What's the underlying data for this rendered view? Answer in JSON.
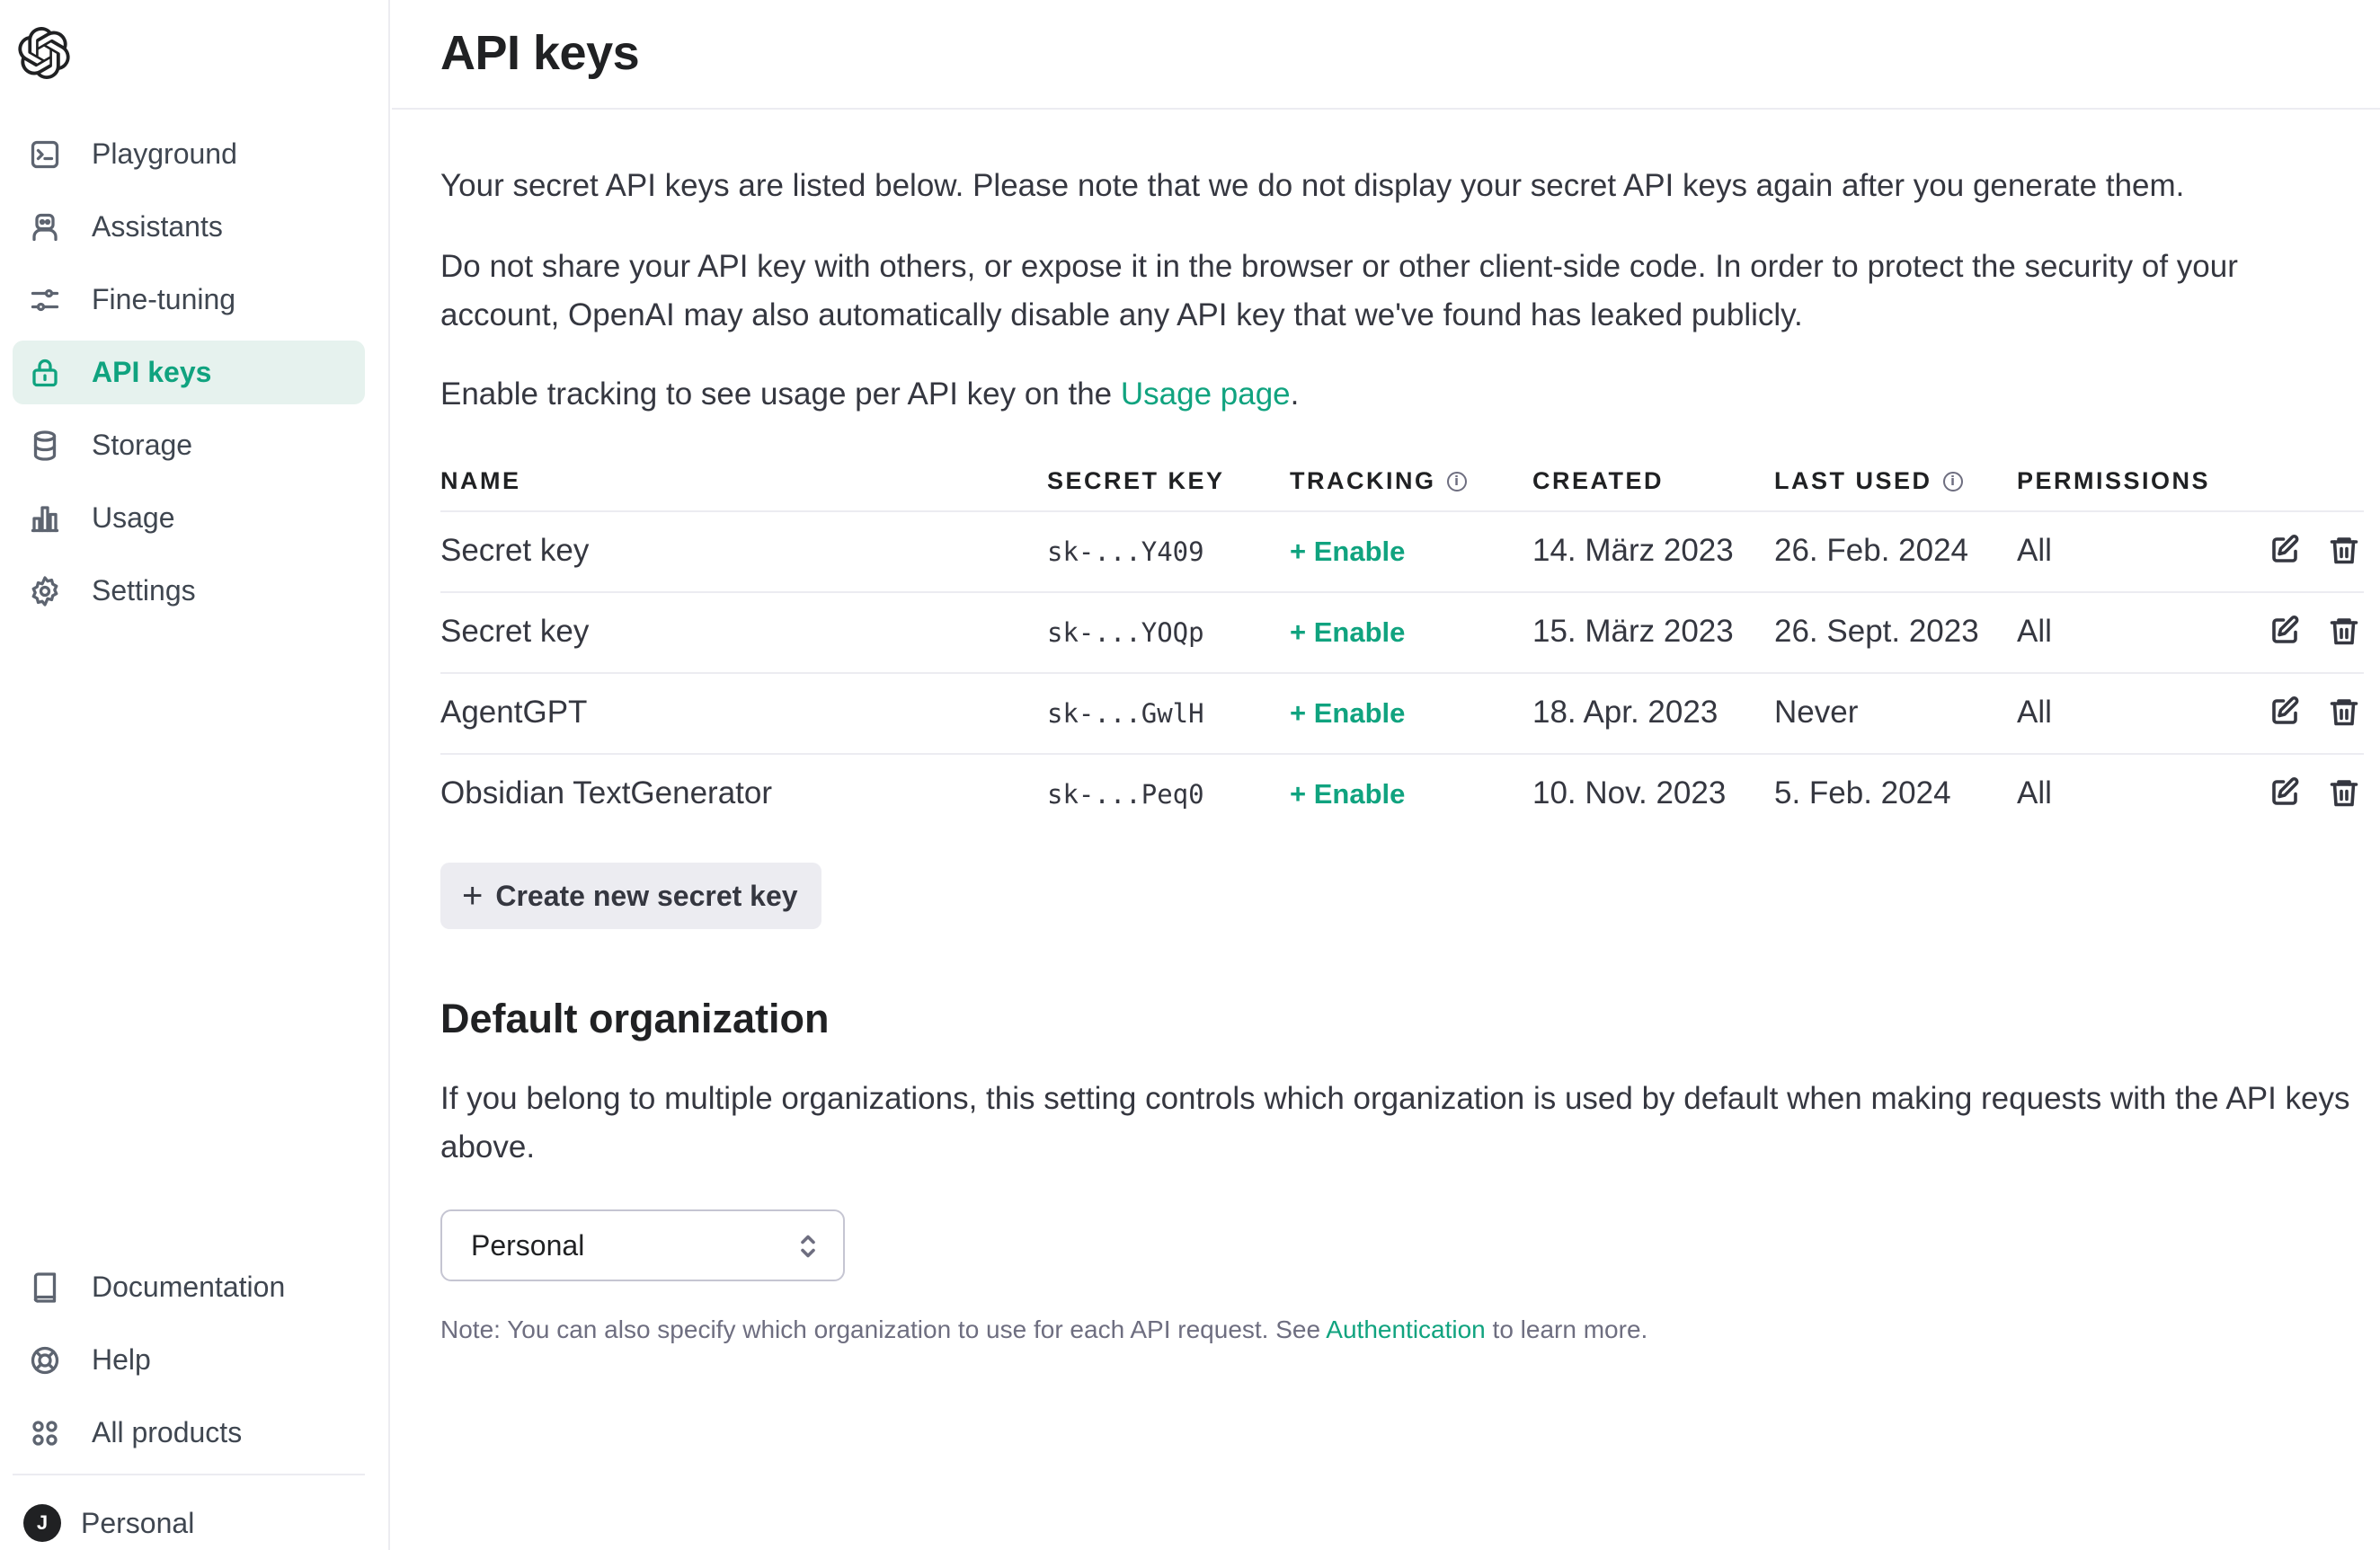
{
  "sidebar": {
    "logo_icon": "openai-logo-icon",
    "nav": [
      {
        "label": "Playground",
        "icon": "terminal-icon",
        "active": false
      },
      {
        "label": "Assistants",
        "icon": "robot-icon",
        "active": false
      },
      {
        "label": "Fine-tuning",
        "icon": "sliders-icon",
        "active": false
      },
      {
        "label": "API keys",
        "icon": "lock-icon",
        "active": true
      },
      {
        "label": "Storage",
        "icon": "database-icon",
        "active": false
      },
      {
        "label": "Usage",
        "icon": "bar-chart-icon",
        "active": false
      },
      {
        "label": "Settings",
        "icon": "gear-icon",
        "active": false
      }
    ],
    "bottom_nav": [
      {
        "label": "Documentation",
        "icon": "book-icon"
      },
      {
        "label": "Help",
        "icon": "lifebuoy-icon"
      },
      {
        "label": "All products",
        "icon": "grid-icon"
      }
    ],
    "user": {
      "initial": "J",
      "name": "Personal"
    }
  },
  "header": {
    "title": "API keys"
  },
  "main": {
    "intro1": "Your secret API keys are listed below. Please note that we do not display your secret API keys again after you generate them.",
    "intro2": "Do not share your API key with others, or expose it in the browser or other client-side code. In order to protect the security of your account, OpenAI may also automatically disable any API key that we've found has leaked publicly.",
    "tracking_prefix": "Enable tracking to see usage per API key on the ",
    "tracking_link": "Usage page",
    "tracking_suffix": ".",
    "table": {
      "columns": {
        "name": "NAME",
        "secret_key": "SECRET KEY",
        "tracking": "TRACKING",
        "created": "CREATED",
        "last_used": "LAST USED",
        "permissions": "PERMISSIONS"
      },
      "rows": [
        {
          "name": "Secret key",
          "secret_key": "sk-...Y409",
          "tracking": "+ Enable",
          "created": "14. März 2023",
          "last_used": "26. Feb. 2024",
          "permissions": "All"
        },
        {
          "name": "Secret key",
          "secret_key": "sk-...YOQp",
          "tracking": "+ Enable",
          "created": "15. März 2023",
          "last_used": "26. Sept. 2023",
          "permissions": "All"
        },
        {
          "name": "AgentGPT",
          "secret_key": "sk-...GwlH",
          "tracking": "+ Enable",
          "created": "18. Apr. 2023",
          "last_used": "Never",
          "permissions": "All"
        },
        {
          "name": "Obsidian TextGenerator",
          "secret_key": "sk-...Peq0",
          "tracking": "+ Enable",
          "created": "10. Nov. 2023",
          "last_used": "5. Feb. 2024",
          "permissions": "All"
        }
      ]
    },
    "create_button": "Create new secret key",
    "default_org": {
      "title": "Default organization",
      "description": "If you belong to multiple organizations, this setting controls which organization is used by default when making requests with the API keys above.",
      "selected": "Personal",
      "note_prefix": "Note: You can also specify which organization to use for each API request. See ",
      "note_link": "Authentication",
      "note_suffix": " to learn more."
    }
  },
  "colors": {
    "accent": "#10a37f",
    "active_bg": "#e6f2ee",
    "divider": "#ececf1"
  }
}
